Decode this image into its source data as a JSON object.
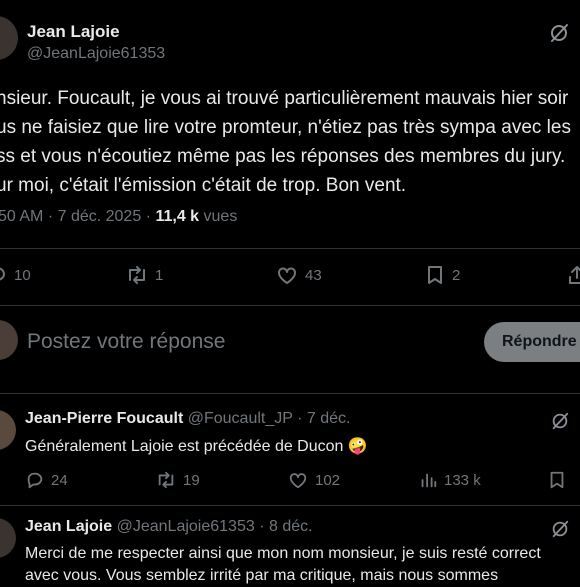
{
  "post": {
    "author_name": "Jean Lajoie",
    "author_handle": "@JeanLajoie61353",
    "body_lines": [
      "nsieur. Foucault, je vous ai trouvé particulièrement mauvais hier soir",
      "us ne faisiez que lire votre promteur, n'étiez pas très sympa avec les",
      "ss et vous n'écoutiez même pas les réponses des membres du jury.",
      "ur moi, c'était l'émission c'était de trop. Bon vent."
    ],
    "time": "50 AM",
    "date": "7 déc. 2025",
    "views_count": "11,4 k",
    "views_label": "vues",
    "actions": {
      "replies": "10",
      "reposts": "1",
      "likes": "43",
      "bookmarks": "2"
    }
  },
  "reply_box": {
    "placeholder": "Postez votre réponse",
    "button": "Répondre"
  },
  "replies": [
    {
      "author_name": "Jean-Pierre Foucault",
      "author_handle": "@Foucault_JP",
      "date": "7 déc.",
      "text": "Généralement Lajoie est précédée de Ducon",
      "emoji": "🤪",
      "actions": {
        "replies": "24",
        "reposts": "19",
        "likes": "102",
        "views": "133 k"
      }
    },
    {
      "author_name": "Jean Lajoie",
      "author_handle": "@JeanLajoie61353",
      "date": "8 déc.",
      "text_lines": [
        "Merci de me respecter ainsi que mon nom monsieur, je suis resté correct",
        "avec vous. Vous semblez irrité par ma critique, mais nous sommes"
      ]
    }
  ],
  "icons": [
    "grok-icon",
    "reply-icon",
    "repost-icon",
    "like-icon",
    "bookmark-icon",
    "share-icon",
    "views-icon"
  ]
}
